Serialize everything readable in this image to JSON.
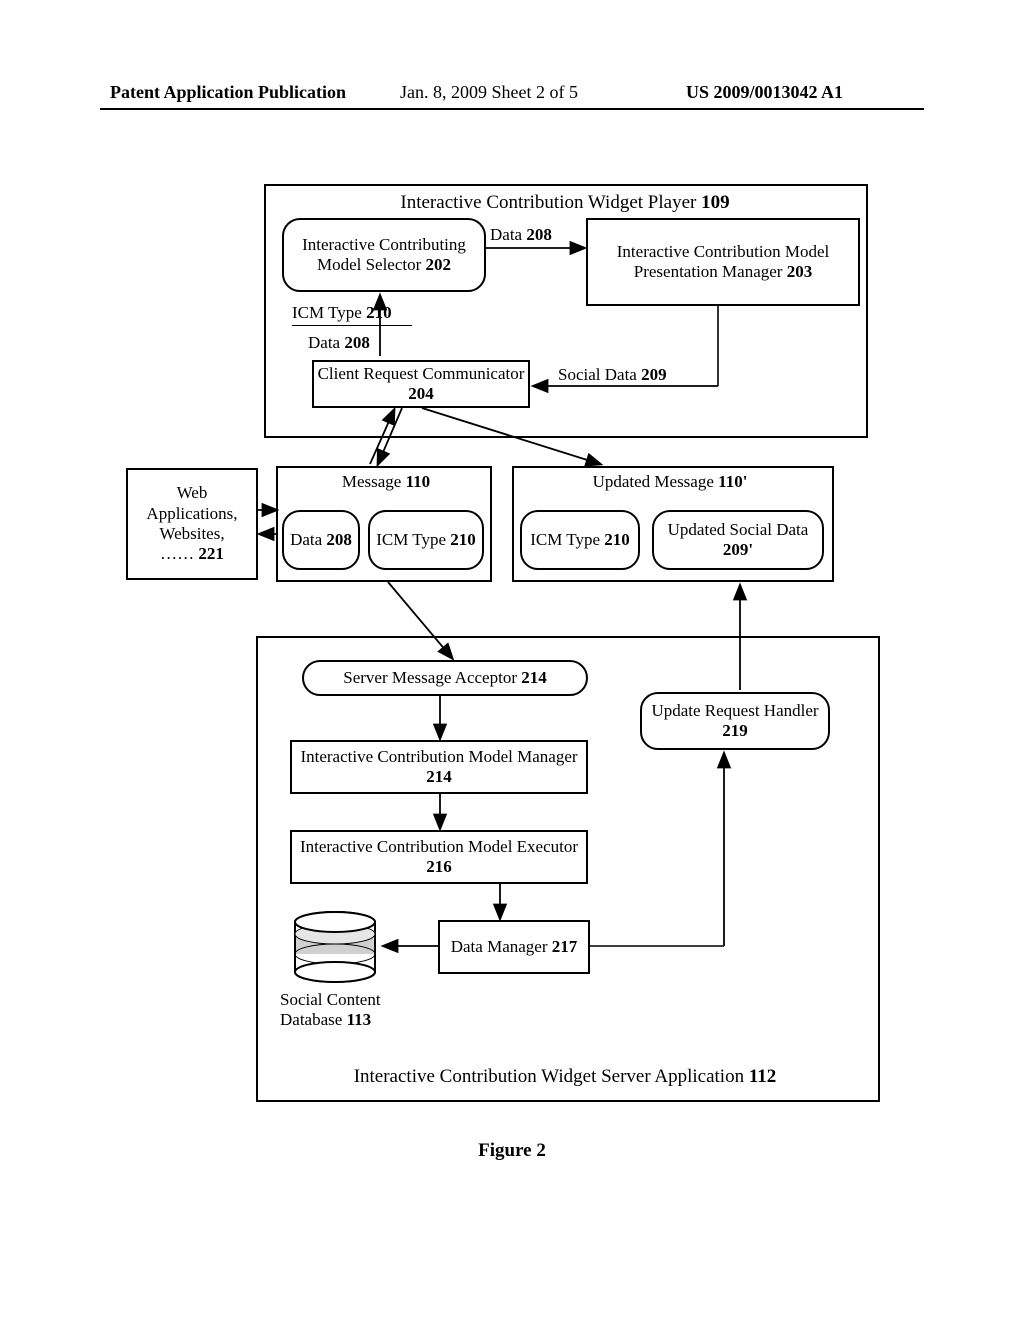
{
  "header": {
    "pub_label": "Patent Application Publication",
    "date": "Jan. 8, 2009  Sheet 2 of 5",
    "pub_no": "US 2009/0013042 A1"
  },
  "figure_caption": "Figure 2",
  "player": {
    "title": "Interactive Contribution Widget Player ",
    "title_ref": "109",
    "selector": "Interactive Contributing Model Selector ",
    "selector_ref": "202",
    "pres_mgr": "Interactive Contribution Model Presentation Manager ",
    "pres_mgr_ref": "203",
    "crc": "Client Request Communicator ",
    "crc_ref": "204",
    "data_label": "Data ",
    "data_ref": "208",
    "icm_type_label": "ICM Type ",
    "icm_type_ref": "210",
    "social_data_label": "Social Data ",
    "social_data_ref": "209"
  },
  "web_apps": {
    "line1": "Web",
    "line2": "Applications,",
    "line3": "Websites,",
    "line4": "…… ",
    "ref": "221"
  },
  "msgbox": {
    "msg": "Message ",
    "msg_ref": "110",
    "umsg": "Updated Message ",
    "umsg_ref": "110'",
    "data": "Data ",
    "data_ref": "208",
    "icm_type": "ICM Type ",
    "icm_type_ref": "210",
    "usd": "Updated Social Data ",
    "usd_ref": "209'"
  },
  "server": {
    "title": "Interactive Contribution Widget Server Application ",
    "title_ref": "112",
    "sma": "Server Message Acceptor ",
    "sma_ref": "214",
    "urh": "Update Request Handler ",
    "urh_ref": "219",
    "icm_mgr": "Interactive Contribution Model Manager ",
    "icm_mgr_ref": "214",
    "icm_exec": "Interactive Contribution Model Executor ",
    "icm_exec_ref": "216",
    "data_mgr": "Data Manager ",
    "data_mgr_ref": "217",
    "db_label": "Social Content Database ",
    "db_ref": "113"
  }
}
